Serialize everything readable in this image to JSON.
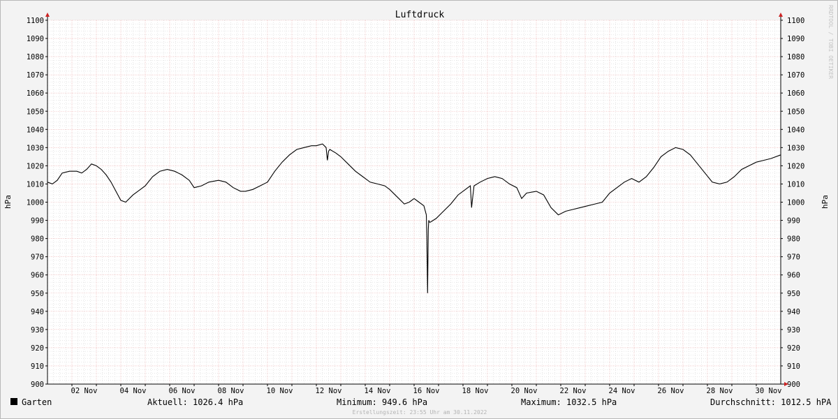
{
  "chart_data": {
    "type": "line",
    "title": "Luftdruck",
    "ylabel": "hPa",
    "ylim": [
      900,
      1100
    ],
    "yticks": [
      900,
      910,
      920,
      930,
      940,
      950,
      960,
      970,
      980,
      990,
      1000,
      1010,
      1020,
      1030,
      1040,
      1050,
      1060,
      1070,
      1080,
      1090,
      1100
    ],
    "xlim_days": [
      1,
      31
    ],
    "xticks": [
      {
        "day": 2,
        "label": "02 Nov"
      },
      {
        "day": 4,
        "label": "04 Nov"
      },
      {
        "day": 6,
        "label": "06 Nov"
      },
      {
        "day": 8,
        "label": "08 Nov"
      },
      {
        "day": 10,
        "label": "10 Nov"
      },
      {
        "day": 12,
        "label": "12 Nov"
      },
      {
        "day": 14,
        "label": "14 Nov"
      },
      {
        "day": 16,
        "label": "16 Nov"
      },
      {
        "day": 18,
        "label": "18 Nov"
      },
      {
        "day": 20,
        "label": "20 Nov"
      },
      {
        "day": 22,
        "label": "22 Nov"
      },
      {
        "day": 24,
        "label": "24 Nov"
      },
      {
        "day": 26,
        "label": "26 Nov"
      },
      {
        "day": 28,
        "label": "28 Nov"
      },
      {
        "day": 30,
        "label": "30 Nov"
      }
    ],
    "grid": true,
    "series": [
      {
        "name": "Garten",
        "color": "#000000",
        "x": [
          1.0,
          1.2,
          1.4,
          1.6,
          1.9,
          2.2,
          2.4,
          2.6,
          2.8,
          3.0,
          3.2,
          3.4,
          3.6,
          3.8,
          4.0,
          4.2,
          4.5,
          4.8,
          5.0,
          5.3,
          5.6,
          5.9,
          6.2,
          6.5,
          6.8,
          7.0,
          7.3,
          7.6,
          8.0,
          8.3,
          8.6,
          8.9,
          9.1,
          9.4,
          9.7,
          10.0,
          10.3,
          10.6,
          10.9,
          11.2,
          11.5,
          11.8,
          12.0,
          12.25,
          12.4,
          12.45,
          12.5,
          12.55,
          12.8,
          13.0,
          13.3,
          13.6,
          13.9,
          14.2,
          14.5,
          14.8,
          15.0,
          15.3,
          15.6,
          15.8,
          16.0,
          16.2,
          16.4,
          16.5,
          16.52,
          16.55,
          16.58,
          16.6,
          16.63,
          16.66,
          16.9,
          17.2,
          17.5,
          17.8,
          18.1,
          18.3,
          18.35,
          18.4,
          18.45,
          18.7,
          19.0,
          19.3,
          19.6,
          19.9,
          20.2,
          20.4,
          20.6,
          21.0,
          21.3,
          21.6,
          21.9,
          22.2,
          22.5,
          22.8,
          23.1,
          23.4,
          23.7,
          24.0,
          24.3,
          24.6,
          24.9,
          25.2,
          25.5,
          25.8,
          26.1,
          26.4,
          26.7,
          27.0,
          27.3,
          27.6,
          27.9,
          28.2,
          28.5,
          28.8,
          29.1,
          29.4,
          29.7,
          30.0,
          30.3,
          30.6,
          31.0
        ],
        "y": [
          1011,
          1010,
          1012,
          1016,
          1017,
          1017,
          1016,
          1018,
          1021,
          1020,
          1018,
          1015,
          1011,
          1006,
          1001,
          1000,
          1004,
          1007,
          1009,
          1014,
          1017,
          1018,
          1017,
          1015,
          1012,
          1008,
          1009,
          1011,
          1012,
          1011,
          1008,
          1006,
          1006,
          1007,
          1009,
          1011,
          1017,
          1022,
          1026,
          1029,
          1030,
          1031,
          1031,
          1032,
          1030,
          1023,
          1028,
          1029,
          1027,
          1025,
          1021,
          1017,
          1014,
          1011,
          1010,
          1009,
          1007,
          1003,
          999,
          1000,
          1002,
          1000,
          998,
          993,
          981,
          950,
          985,
          990,
          989,
          989,
          991,
          995,
          999,
          1004,
          1007,
          1009,
          997,
          1003,
          1009,
          1011,
          1013,
          1014,
          1013,
          1010,
          1008,
          1002,
          1005,
          1006,
          1004,
          997,
          993,
          995,
          996,
          997,
          998,
          999,
          1000,
          1005,
          1008,
          1011,
          1013,
          1011,
          1014,
          1019,
          1025,
          1028,
          1030,
          1029,
          1026,
          1021,
          1016,
          1011,
          1010,
          1011,
          1014,
          1018,
          1020,
          1022,
          1023,
          1024,
          1026
        ]
      }
    ]
  },
  "legend": {
    "series_name": "Garten",
    "current": "Aktuell: 1026.4 hPa",
    "minimum": "Minimum: 949.6 hPa",
    "maximum": "Maximum: 1032.5 hPa",
    "average": "Durchschnitt: 1012.5 hPA"
  },
  "watermark": "RRDTOOL / TOBI OETIKER",
  "footer": "Erstellungszeit: 23:55 Uhr am 30.11.2022",
  "colors": {
    "grid_major": "#e8a0a0",
    "grid_minor": "#cfcfcf",
    "axis": "#000000",
    "arrow": "#cc2222",
    "canvas": "#ffffff",
    "background": "#f3f3f3"
  }
}
